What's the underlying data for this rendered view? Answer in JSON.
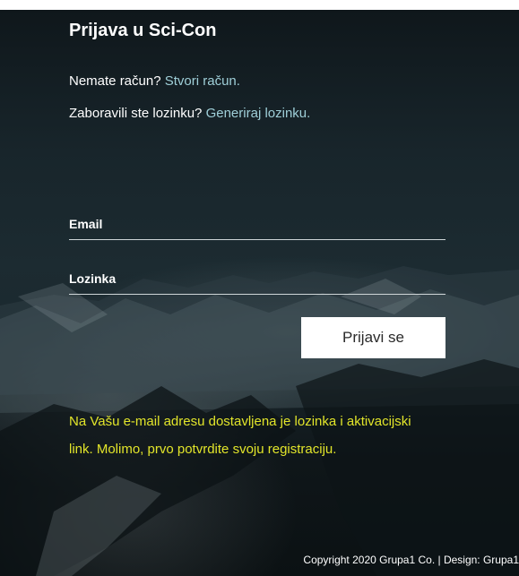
{
  "header": {
    "title": "Prijava u Sci-Con"
  },
  "register": {
    "prompt": "Nemate račun?",
    "link": "Stvori račun."
  },
  "forgot": {
    "prompt": "Zaboravili ste lozinku?",
    "link": "Generiraj lozinku."
  },
  "form": {
    "email_label": "Email",
    "email_value": "",
    "password_label": "Lozinka",
    "password_value": "",
    "submit_label": "Prijavi se"
  },
  "notice": {
    "text": "Na Vašu e-mail adresu dostavljena je lozinka i aktivacijski link. Molimo, prvo potvrdite svoju registraciju."
  },
  "footer": {
    "text": "Copyright 2020 Grupa1 Co. | Design: Grupa1"
  },
  "colors": {
    "link": "#9fcfd8",
    "notice": "#e2e52a",
    "background": "#16232a",
    "button_bg": "#ffffff"
  }
}
